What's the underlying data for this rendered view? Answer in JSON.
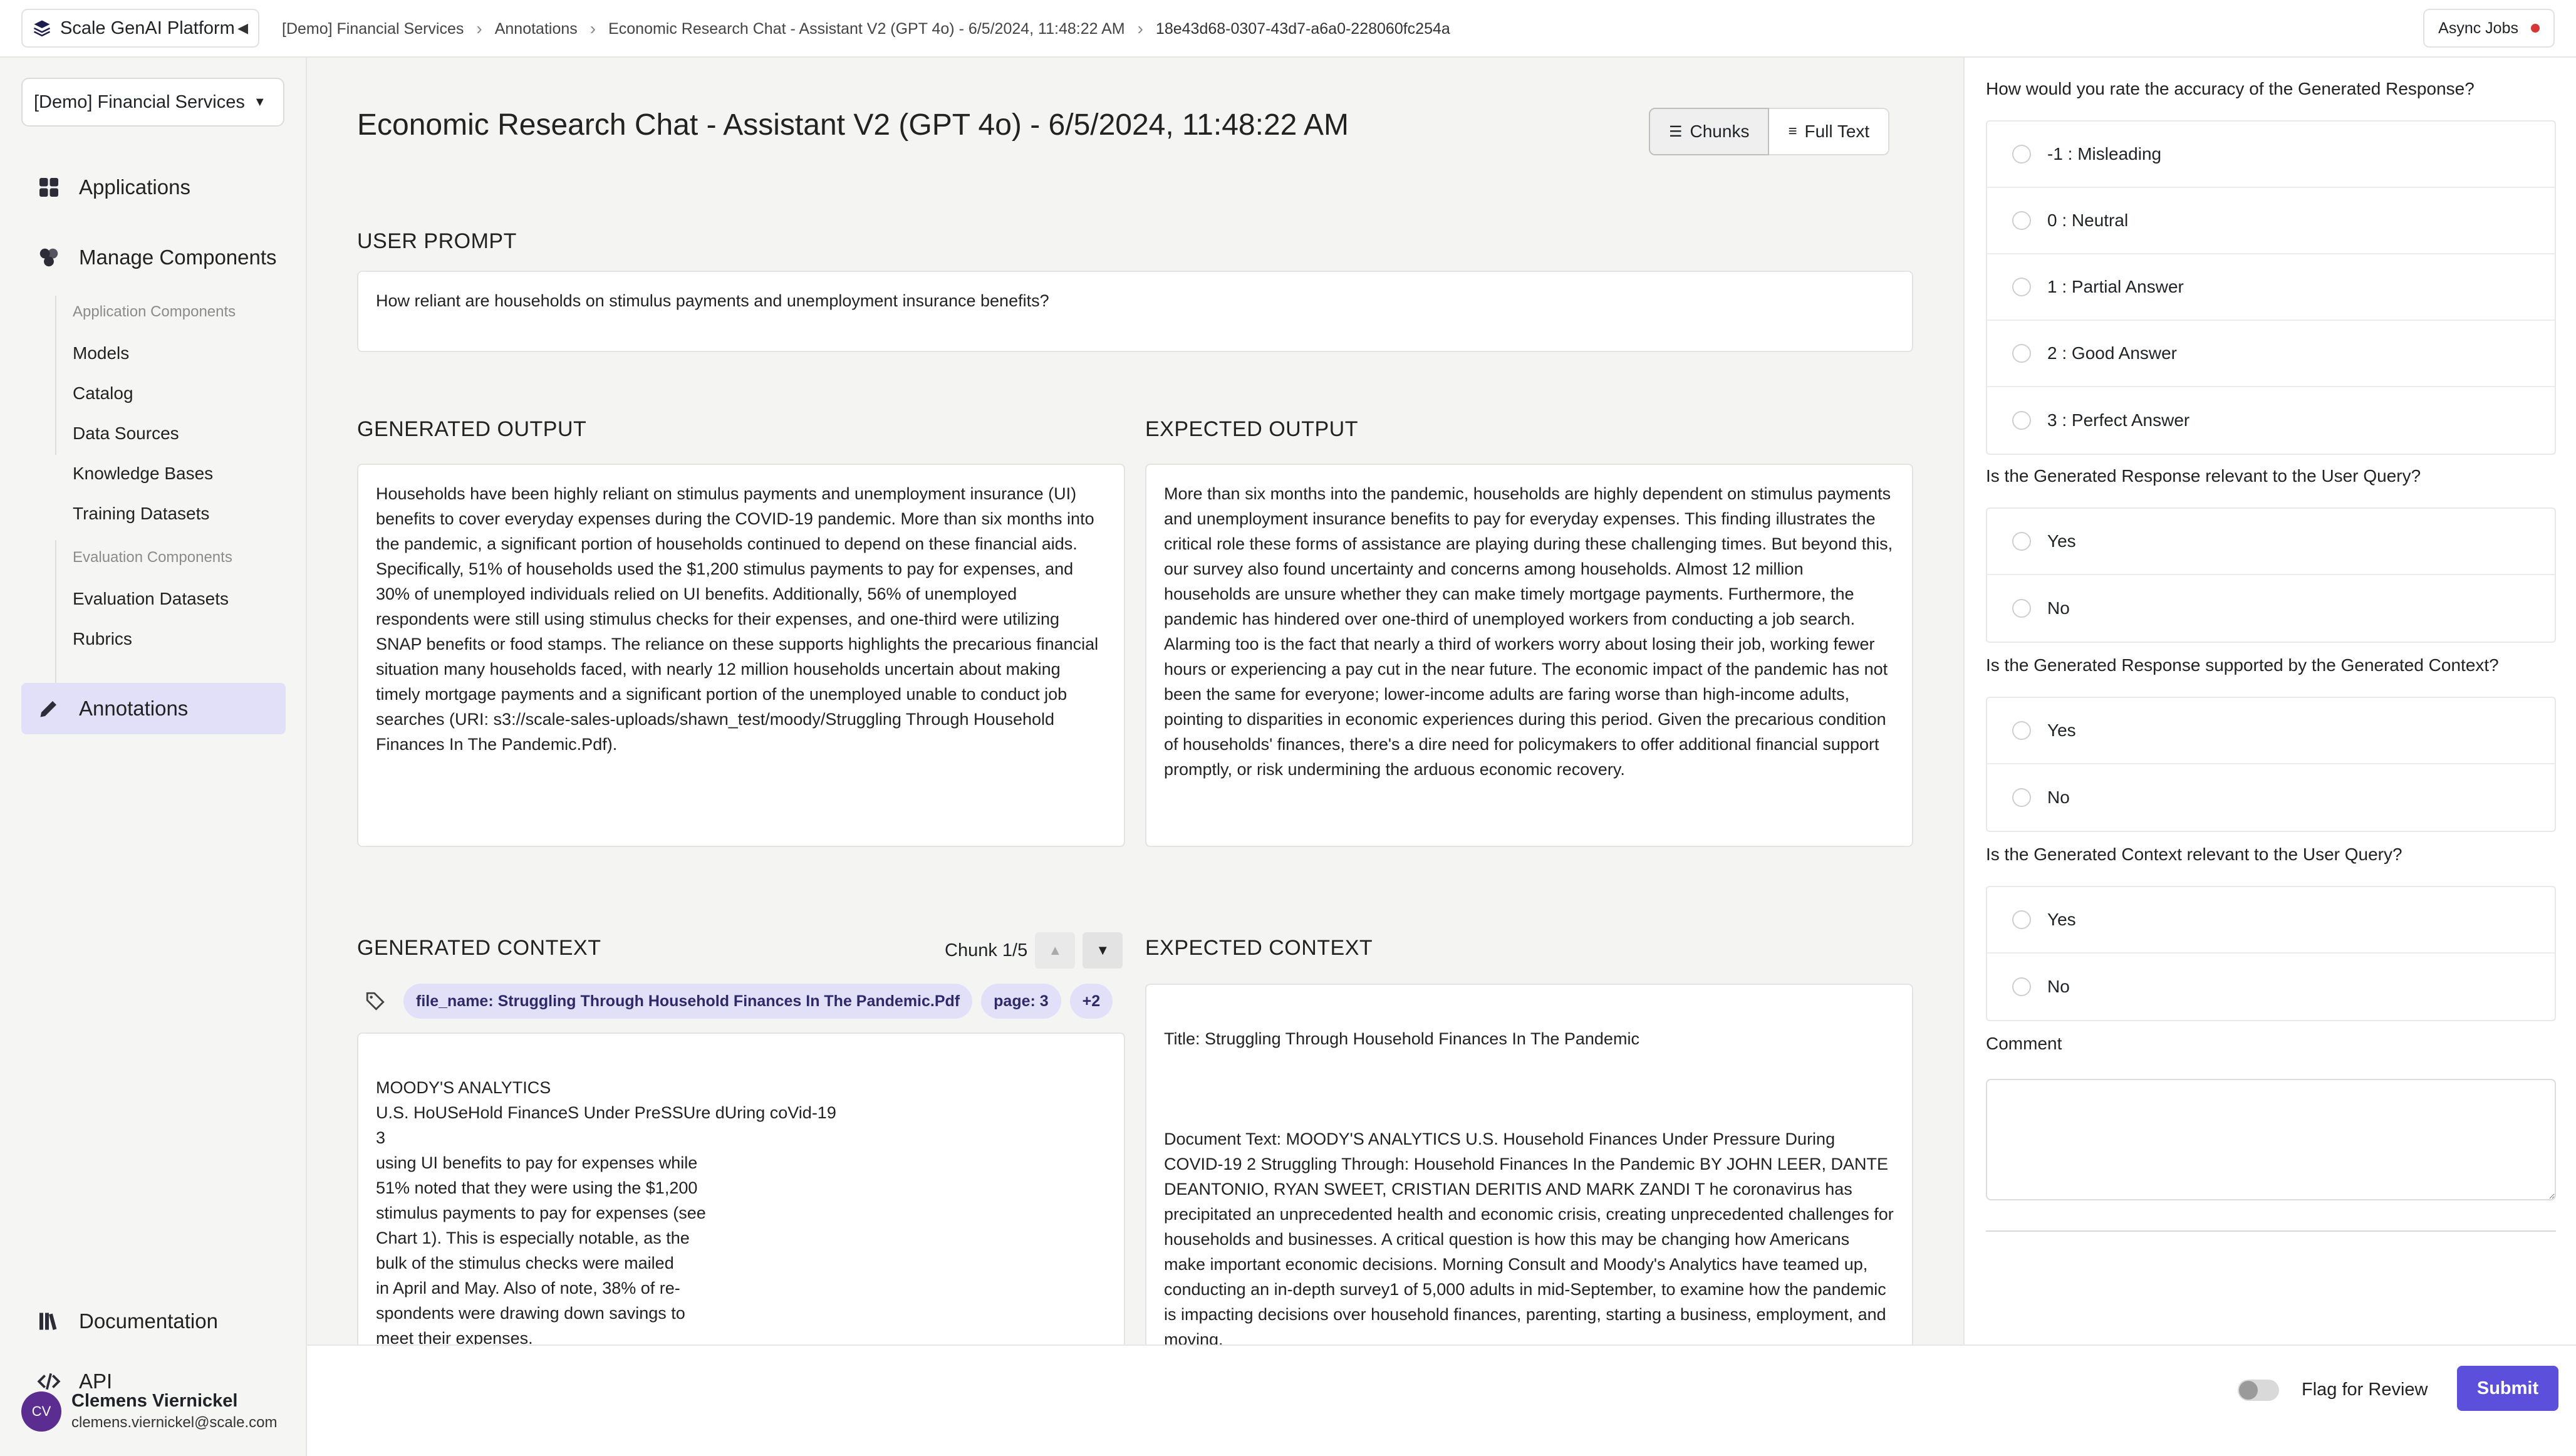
{
  "topbar": {
    "brand": "Scale GenAI Platform",
    "breadcrumbs": [
      "[Demo] Financial Services",
      "Annotations",
      "Economic Research Chat - Assistant V2 (GPT 4o) - 6/5/2024, 11:48:22 AM",
      "18e43d68-0307-43d7-a6a0-228060fc254a"
    ],
    "async_jobs": "Async Jobs"
  },
  "sidebar": {
    "org": "[Demo] Financial Services",
    "applications": "Applications",
    "manage_components": "Manage Components",
    "app_components_header": "Application Components",
    "app_components": [
      "Models",
      "Catalog",
      "Data Sources",
      "Knowledge Bases",
      "Training Datasets"
    ],
    "eval_components_header": "Evaluation Components",
    "eval_components": [
      "Evaluation Datasets",
      "Rubrics"
    ],
    "annotations": "Annotations",
    "documentation": "Documentation",
    "api": "API",
    "user": {
      "initials": "CV",
      "name": "Clemens Viernickel",
      "email": "clemens.viernickel@scale.com"
    }
  },
  "main": {
    "title": "Economic Research Chat - Assistant V2 (GPT 4o) - 6/5/2024, 11:48:22 AM",
    "view_toggle": {
      "chunks": "Chunks",
      "full_text": "Full Text"
    },
    "user_prompt": {
      "header": "USER PROMPT",
      "text": "How reliant are households on stimulus payments and unemployment insurance benefits?"
    },
    "generated_output": {
      "header": "GENERATED OUTPUT",
      "text": "Households have been highly reliant on stimulus payments and unemployment insurance (UI) benefits to cover everyday expenses during the COVID-19 pandemic. More than six months into the pandemic, a significant portion of households continued to depend on these financial aids. Specifically, 51% of households used the $1,200 stimulus payments to pay for expenses, and 30% of unemployed individuals relied on UI benefits. Additionally, 56% of unemployed respondents were still using stimulus checks for their expenses, and one-third were utilizing SNAP benefits or food stamps. The reliance on these supports highlights the precarious financial situation many households faced, with nearly 12 million households uncertain about making timely mortgage payments and a significant portion of the unemployed unable to conduct job searches (URI: s3://scale-sales-uploads/shawn_test/moody/Struggling Through Household Finances In The Pandemic.Pdf)."
    },
    "expected_output": {
      "header": "EXPECTED OUTPUT",
      "text": "More than six months into the pandemic, households are highly dependent on stimulus payments and unemployment insurance benefits to pay for everyday expenses. This finding illustrates the critical role these forms of assistance are playing during these challenging times. But beyond this, our survey also found uncertainty and concerns among households. Almost 12 million households are unsure whether they can make timely mortgage payments. Furthermore, the pandemic has hindered over one-third of unemployed workers from conducting a job search. Alarming too is the fact that nearly a third of workers worry about losing their job, working fewer hours or experiencing a pay cut in the near future. The economic impact of the pandemic has not been the same for everyone; lower-income adults are faring worse than high-income adults, pointing to disparities in economic experiences during this period. Given the precarious condition of households' finances, there's a dire need for policymakers to offer additional financial support promptly, or risk undermining the arduous economic recovery."
    },
    "generated_context": {
      "header": "GENERATED CONTEXT",
      "chunk_label": "Chunk 1/5",
      "tags": [
        "file_name: Struggling Through Household Finances In The Pandemic.Pdf",
        "page: 3",
        "+2"
      ],
      "text": "MOODY'S ANALYTICS\nU.S. HoUSeHold FinanceS Under PreSSUre dUring coVid-19\n3\nusing UI benefits to pay for expenses while\n51% noted that they were using the $1,200\nstimulus payments to pay for expenses (see\nChart 1). This is especially notable, as the\nbulk of the stimulus checks were mailed\nin April and May. Also of note, 38% of re-\nspondents were drawing down savings to\nmeet their expenses.\nOf those who were unemployed at the"
    },
    "expected_context": {
      "header": "EXPECTED CONTEXT",
      "title_line": "Title: Struggling Through Household Finances In The Pandemic",
      "text": "Document Text: MOODY'S ANALYTICS U.S. Household Finances Under Pressure During COVID-19 2 Struggling Through: Household Finances In  the Pandemic BY JOHN LEER, DANTE DEANTONIO, RYAN SWEET, CRISTIAN DERITIS AND MARK ZANDI  T he coronavirus has precipitated an unprecedented health and economic crisis, creating unprecedented  challenges for households and businesses. A critical question is how this may be changing how Americans  make important economic decisions. Morning Consult and Moody's Analytics have teamed up, conducting  an in-depth survey1 of 5,000 adults in mid-September, to examine how the pandemic is impacting decisions over  household finances, parenting, starting a business, employment, and moving.\nIn this paper, we explore the impact of  the pandemic on household finances. The key findings are as follows:  » More than six months into the  pandemic, households remain highly  dependent on stimulus payments  and unemployment insurance benefits  to pay"
    }
  },
  "rubric": {
    "q1": {
      "question": "How would you rate the accuracy of the Generated Response?",
      "options": [
        "-1 : Misleading",
        "0 : Neutral",
        "1 : Partial Answer",
        "2 : Good Answer",
        "3 : Perfect Answer"
      ]
    },
    "q2": {
      "question": "Is the Generated Response relevant to the User Query?",
      "options": [
        "Yes",
        "No"
      ]
    },
    "q3": {
      "question": "Is the Generated Response supported by the Generated Context?",
      "options": [
        "Yes",
        "No"
      ]
    },
    "q4": {
      "question": "Is the Generated Context relevant to the User Query?",
      "options": [
        "Yes",
        "No"
      ]
    },
    "comment_label": "Comment"
  },
  "footer": {
    "flag_label": "Flag for Review",
    "submit": "Submit"
  },
  "colors": {
    "accent": "#5b4fdc",
    "active_nav": "#e2e0f8",
    "tag_bg": "#e2e0f8",
    "async_dot": "#d63636"
  }
}
